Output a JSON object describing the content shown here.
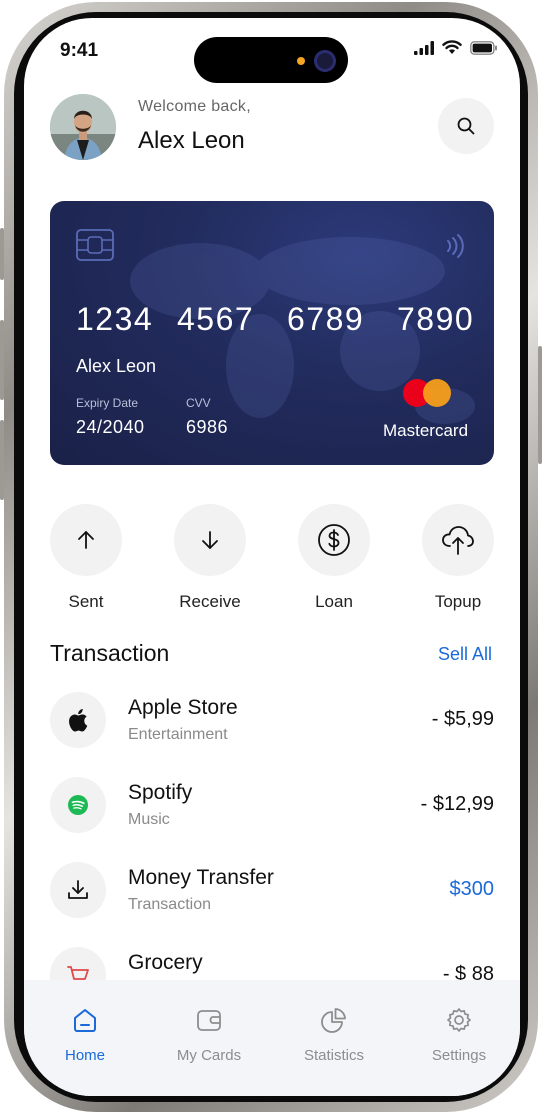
{
  "status_bar": {
    "time": "9:41"
  },
  "header": {
    "welcome": "Welcome back,",
    "name": "Alex Leon"
  },
  "card": {
    "number_groups": [
      "1234",
      "4567",
      "6789",
      "7890"
    ],
    "holder": "Alex Leon",
    "expiry_label": "Expiry Date",
    "expiry_value": "24/2040",
    "cvv_label": "CVV",
    "cvv_value": "6986",
    "brand": "Mastercard",
    "colors": {
      "bg_start": "#2c3a7a",
      "bg_end": "#1a2148",
      "mc_red": "#eb001b",
      "mc_orange": "#f79e1b"
    }
  },
  "actions": [
    {
      "label": "Sent",
      "icon": "arrow-up-icon"
    },
    {
      "label": "Receive",
      "icon": "arrow-down-icon"
    },
    {
      "label": "Loan",
      "icon": "dollar-circle-icon"
    },
    {
      "label": "Topup",
      "icon": "cloud-upload-icon"
    }
  ],
  "transactions": {
    "title": "Transaction",
    "see_all": "Sell All",
    "items": [
      {
        "name": "Apple Store",
        "category": "Entertainment",
        "amount": "- $5,99",
        "icon": "apple-icon"
      },
      {
        "name": "Spotify",
        "category": "Music",
        "amount": "- $12,99",
        "icon": "spotify-icon"
      },
      {
        "name": "Money Transfer",
        "category": "Transaction",
        "amount": "$300",
        "icon": "download-icon"
      },
      {
        "name": "Grocery",
        "category": "",
        "amount": "- $ 88",
        "icon": "basket-icon"
      }
    ]
  },
  "bottom_nav": {
    "items": [
      {
        "label": "Home",
        "icon": "home-icon",
        "active": true
      },
      {
        "label": "My Cards",
        "icon": "wallet-icon",
        "active": false
      },
      {
        "label": "Statistics",
        "icon": "pie-chart-icon",
        "active": false
      },
      {
        "label": "Settings",
        "icon": "gear-icon",
        "active": false
      }
    ]
  },
  "colors": {
    "accent": "#1a6ad9",
    "surface": "#f2f2f2"
  }
}
